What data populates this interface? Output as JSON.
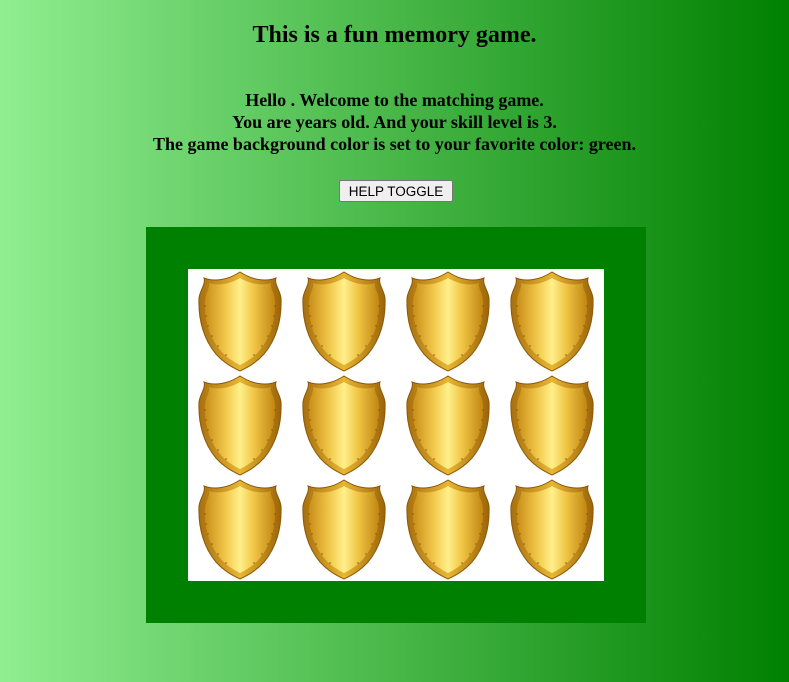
{
  "title": "This is a fun memory game.",
  "welcome": {
    "line1": "Hello . Welcome to the matching game.",
    "line2": "You are years old. And your skill level is 3.",
    "line3": "The game background color is set to your favorite color: green."
  },
  "help_button_label": "HELP TOGGLE",
  "colors": {
    "background_start": "#90ee90",
    "background_end": "#008000",
    "board": "#008000",
    "card_back": "#d4a017"
  },
  "grid": {
    "rows": 3,
    "columns": 4,
    "card_back_icon": "gold-shield-icon"
  }
}
